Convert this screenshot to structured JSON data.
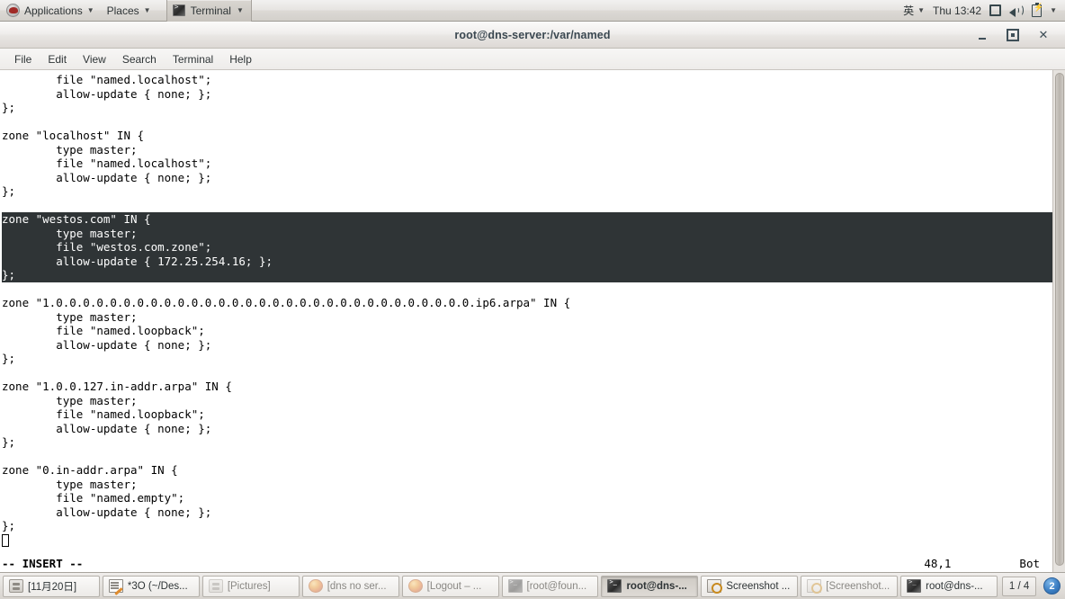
{
  "top_panel": {
    "applications_label": "Applications",
    "places_label": "Places",
    "window_label": "Terminal",
    "input_method": "英",
    "clock": "Thu 13:42",
    "icons": [
      "display-icon",
      "volume-icon",
      "battery-icon",
      "chevron-down-icon"
    ]
  },
  "window": {
    "title": "root@dns-server:/var/named",
    "buttons": {
      "minimize": "minimize-button",
      "maximize": "maximize-button",
      "close": "close-button"
    },
    "menu": [
      "File",
      "Edit",
      "View",
      "Search",
      "Terminal",
      "Help"
    ]
  },
  "terminal": {
    "lines": [
      {
        "text": "        file \"named.localhost\";",
        "selected": false
      },
      {
        "text": "        allow-update { none; };",
        "selected": false
      },
      {
        "text": "};",
        "selected": false
      },
      {
        "text": "",
        "selected": false
      },
      {
        "text": "zone \"localhost\" IN {",
        "selected": false
      },
      {
        "text": "        type master;",
        "selected": false
      },
      {
        "text": "        file \"named.localhost\";",
        "selected": false
      },
      {
        "text": "        allow-update { none; };",
        "selected": false
      },
      {
        "text": "};",
        "selected": false
      },
      {
        "text": "",
        "selected": false
      },
      {
        "text": "zone \"westos.com\" IN {",
        "selected": true
      },
      {
        "text": "        type master;",
        "selected": true
      },
      {
        "text": "        file \"westos.com.zone\";",
        "selected": true
      },
      {
        "text": "        allow-update { 172.25.254.16; };",
        "selected": true
      },
      {
        "text": "};",
        "selected": true
      },
      {
        "text": "",
        "selected": false
      },
      {
        "text": "zone \"1.0.0.0.0.0.0.0.0.0.0.0.0.0.0.0.0.0.0.0.0.0.0.0.0.0.0.0.0.0.0.0.ip6.arpa\" IN {",
        "selected": false
      },
      {
        "text": "        type master;",
        "selected": false
      },
      {
        "text": "        file \"named.loopback\";",
        "selected": false
      },
      {
        "text": "        allow-update { none; };",
        "selected": false
      },
      {
        "text": "};",
        "selected": false
      },
      {
        "text": "",
        "selected": false
      },
      {
        "text": "zone \"1.0.0.127.in-addr.arpa\" IN {",
        "selected": false
      },
      {
        "text": "        type master;",
        "selected": false
      },
      {
        "text": "        file \"named.loopback\";",
        "selected": false
      },
      {
        "text": "        allow-update { none; };",
        "selected": false
      },
      {
        "text": "};",
        "selected": false
      },
      {
        "text": "",
        "selected": false
      },
      {
        "text": "zone \"0.in-addr.arpa\" IN {",
        "selected": false
      },
      {
        "text": "        type master;",
        "selected": false
      },
      {
        "text": "        file \"named.empty\";",
        "selected": false
      },
      {
        "text": "        allow-update { none; };",
        "selected": false
      },
      {
        "text": "};",
        "selected": false
      }
    ],
    "status": {
      "mode": "-- INSERT --",
      "position": "48,1",
      "location": "Bot"
    },
    "colors": {
      "background": "#ffffff",
      "foreground": "#000000",
      "selection_background": "#2f3436",
      "selection_foreground": "#ffffff"
    }
  },
  "taskbar": {
    "items": [
      {
        "label": "[11月20日]",
        "icon": "files-icon",
        "state": "normal"
      },
      {
        "label": "*3O (~/Des...",
        "icon": "gedit-icon",
        "state": "normal"
      },
      {
        "label": "[Pictures]",
        "icon": "files-icon",
        "state": "minimized"
      },
      {
        "label": "[dns no ser...",
        "icon": "firefox-icon",
        "state": "minimized"
      },
      {
        "label": "[Logout – ...",
        "icon": "firefox-icon",
        "state": "minimized"
      },
      {
        "label": "[root@foun...",
        "icon": "terminal-icon",
        "state": "minimized"
      },
      {
        "label": "root@dns-...",
        "icon": "terminal-icon",
        "state": "active"
      },
      {
        "label": "Screenshot ...",
        "icon": "screenshot-icon",
        "state": "normal"
      },
      {
        "label": "[Screenshot...",
        "icon": "screenshot-icon",
        "state": "minimized"
      },
      {
        "label": "root@dns-...",
        "icon": "terminal-icon",
        "state": "normal"
      }
    ],
    "workspace": "1 / 4",
    "notification_count": "2"
  }
}
